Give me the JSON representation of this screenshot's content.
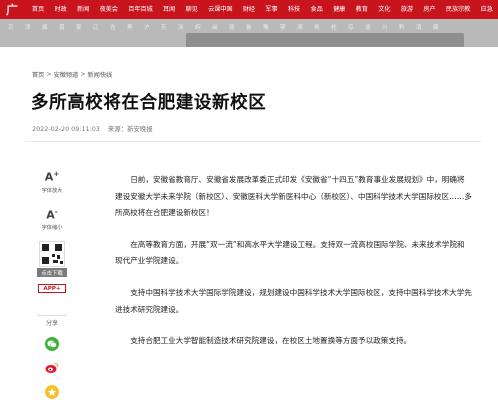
{
  "logo": {
    "main": "央",
    "second": "广网"
  },
  "nav": [
    "首页",
    "时政",
    "新闻",
    "夜美会",
    "百年百城",
    "耳闻",
    "聊见",
    "云课中国",
    "财经",
    "军事",
    "科技",
    "食品",
    "健康",
    "教育",
    "文化",
    "旅游",
    "房产",
    "民族宗教",
    "应急"
  ],
  "cities": [
    "京",
    "津",
    "冀",
    "晋",
    "蒙",
    "辽",
    "吉",
    "黑",
    "沪",
    "苏",
    "浙",
    "皖",
    "闽",
    "赣",
    "鲁",
    "豫",
    "鄂",
    "湘",
    "粤",
    "桂",
    "琼",
    "渝",
    "川",
    "黔",
    "滇",
    "藏"
  ],
  "breadcrumb": [
    "首页",
    "安徽频道",
    "新闻快线"
  ],
  "article": {
    "title": "多所高校将在合肥建设新校区",
    "datetime": "2022-02-20 09:11:03",
    "source_label": "来源：",
    "source": "新安晚报",
    "paragraphs": [
      "日前，安徽省教育厅、安徽省发展改革委正式印发《安徽省“十四五”教育事业发展规划》中，明确将建设安徽大学未来学院（新校区）、安徽医科大学新医科中心（新校区）、中国科学技术大学国际校区……多所高校将在合肥建设新校区！",
      "在高等教育方面，开展“双一流”和高水平大学建设工程。支持双一流高校国际学院、未来技术学院和现代产业学院建设。",
      "支持中国科学技术大学国际学院建设，规划建设中国科学技术大学国际校区，支持中国科学技术大学先进技术研究院建设。",
      "支持合肥工业大学智能制造技术研究院建设，在校区土地置换等方面予以政策支持。"
    ]
  },
  "sidebar": {
    "font_increase_label": "字体放大",
    "font_decrease_label": "字体缩小",
    "qr_label": "点击下载",
    "app_badge": "APP",
    "share_label": "分享"
  },
  "icons": [
    "font-increase-icon",
    "font-decrease-icon",
    "qr-code-icon",
    "wechat-icon",
    "weibo-icon",
    "qzone-icon"
  ],
  "colors": {
    "brand_red": "#c8151d",
    "wechat_green": "#3ab53a"
  }
}
